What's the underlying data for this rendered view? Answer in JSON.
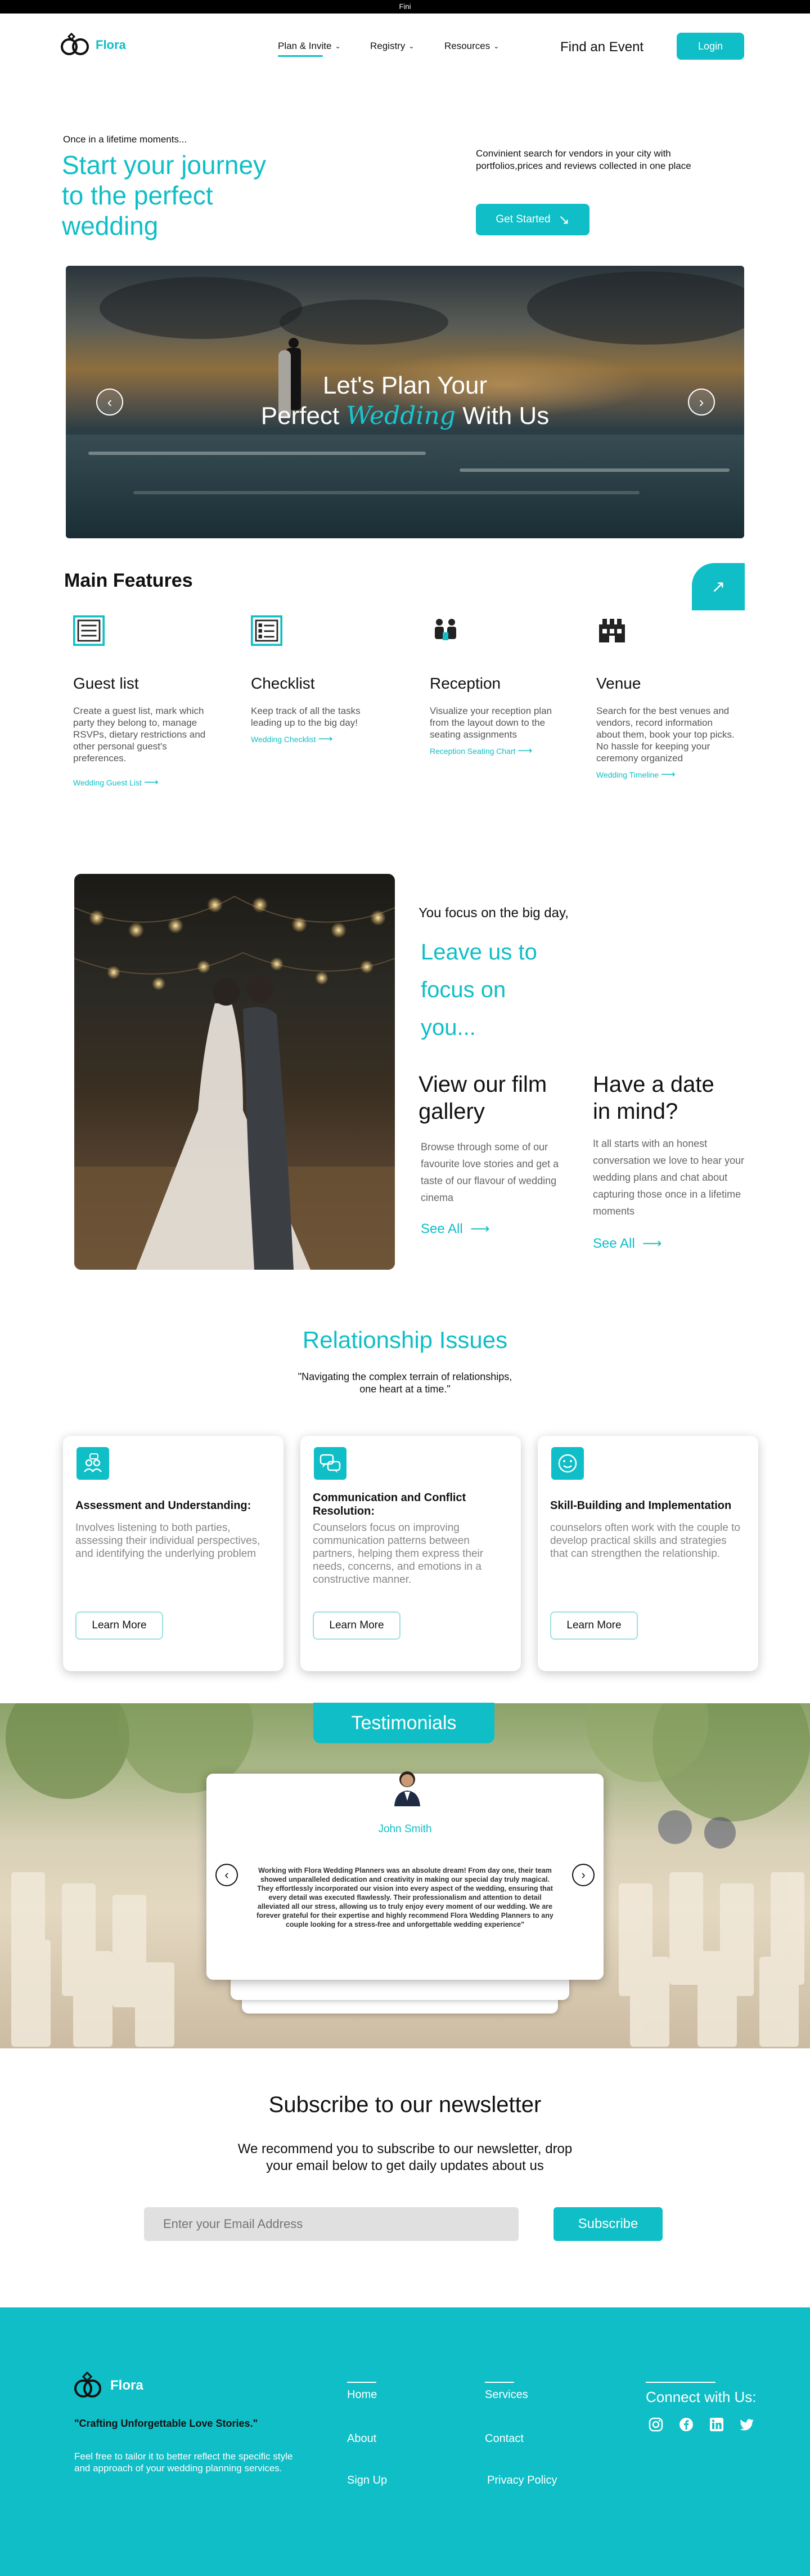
{
  "topbar": {
    "text": "Fini"
  },
  "header": {
    "brand": "Flora",
    "nav": [
      {
        "label": "Plan & Invite"
      },
      {
        "label": "Registry"
      },
      {
        "label": "Resources"
      }
    ],
    "find_event": "Find an Event",
    "login": "Login"
  },
  "hero": {
    "kicker": "Once in a lifetime moments...",
    "title_line1": "Start your journey",
    "title_line2": "to the perfect",
    "title_line3": "wedding",
    "side_text": "Convinient search for vendors in your city with portfolios,prices and reviews collected in one place",
    "cta": "Get Started",
    "banner_line1": "Let's Plan Your",
    "banner_line2_a": "Perfect",
    "banner_line2_script": "Wedding",
    "banner_line2_b": "With Us"
  },
  "features": {
    "heading": "Main Features",
    "items": [
      {
        "title": "Guest list",
        "text": "Create a guest list, mark which party they belong to, manage RSVPs, dietary restrictions and other personal guest's preferences.",
        "link": "Wedding Guest List",
        "icon": "list-icon"
      },
      {
        "title": "Checklist",
        "text": "Keep track of all the tasks leading up to the big day!",
        "link": "Wedding Checklist",
        "icon": "checklist-icon"
      },
      {
        "title": "Reception",
        "text": "Visualize your reception plan from the layout down to the seating assignments",
        "link": "Reception Seating Chart",
        "icon": "people-icon"
      },
      {
        "title": "Venue",
        "text": "Search for the best venues and vendors, record information about them, book your top picks.\nNo hassle for keeping your ceremony organized",
        "link": "Wedding Timeline",
        "icon": "building-icon"
      }
    ]
  },
  "split": {
    "lead": "You focus on the big day,",
    "tag_line1": "Leave us to",
    "tag_line2": "focus on",
    "tag_line3": "you...",
    "gallery_title_1": "View our film",
    "gallery_title_2": "gallery",
    "gallery_text": "Browse through some of our favourite love stories and get a taste of our flavour of wedding cinema",
    "gallery_link": "See All",
    "date_title_1": "Have a date",
    "date_title_2": "in mind?",
    "date_text": "It all starts with an honest conversation we love to hear your wedding plans and chat about capturing those once in a lifetime moments",
    "date_link": "See All"
  },
  "relationship": {
    "heading": "Relationship Issues",
    "quote_1": "\"Navigating the complex terrain of relationships,",
    "quote_2": "one heart at a time.\"",
    "cards": [
      {
        "title": "Assessment and Understanding:",
        "text": "Involves listening to both parties, assessing their individual perspectives, and identifying the underlying problem",
        "button": "Learn More",
        "icon": "people-chat-icon"
      },
      {
        "title": "Communication and Conflict Resolution:",
        "text": "Counselors focus on improving communication patterns between partners, helping them express their needs, concerns, and emotions in a constructive manner.",
        "button": "Learn More",
        "icon": "speech-bubbles-icon"
      },
      {
        "title": "Skill-Building and Implementation",
        "text": "counselors often work with the couple to develop practical skills and strategies that can strengthen the relationship.",
        "button": "Learn More",
        "icon": "smiley-icon"
      }
    ]
  },
  "testimonials": {
    "heading": "Testimonials",
    "name": "John Smith",
    "quote": "Working with Flora Wedding Planners was an absolute dream! From day one, their team showed unparalleled dedication and creativity in making our special day truly magical. They effortlessly incorporated our vision into every aspect of the wedding, ensuring that every detail was executed flawlessly. Their professionalism and attention to detail alleviated all our stress, allowing us to truly enjoy every moment of our wedding. We are forever grateful for their expertise and highly recommend Flora Wedding Planners to any couple looking for a stress-free and unforgettable wedding experience\""
  },
  "newsletter": {
    "heading": "Subscribe to our newsletter",
    "text_1": "We recommend you to subscribe to our newsletter, drop",
    "text_2": "your email below to get daily updates about us",
    "placeholder": "Enter your Email Address",
    "button": "Subscribe"
  },
  "footer": {
    "brand": "Flora",
    "tagline": "\"Crafting Unforgettable Love Stories.\"",
    "blurb": "Feel free to tailor it to better reflect the specific style and approach of your wedding planning services.",
    "col1": [
      "Home",
      "About",
      "Sign Up"
    ],
    "col2": [
      "Services",
      "Contact",
      "Privacy Policy"
    ],
    "connect": "Connect with Us:",
    "social": [
      "instagram-icon",
      "facebook-icon",
      "linkedin-icon",
      "twitter-icon"
    ]
  },
  "colors": {
    "accent": "#0fbec6",
    "text": "#111111",
    "muted": "#555555"
  }
}
